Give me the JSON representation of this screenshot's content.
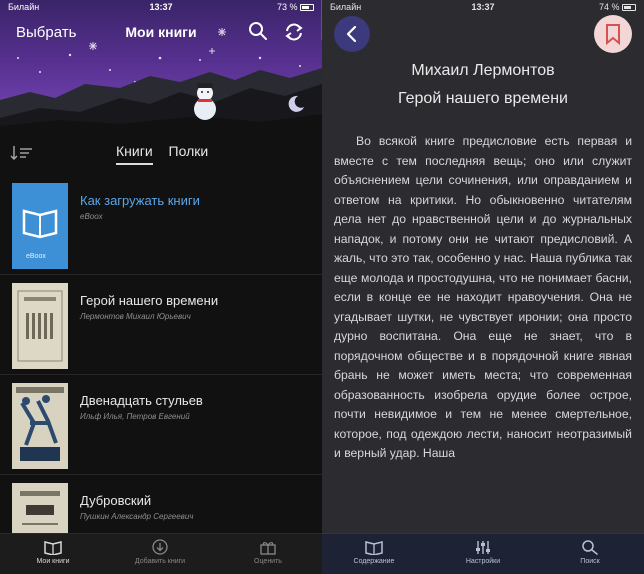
{
  "left": {
    "status": {
      "carrier": "Билайн",
      "time": "13:37",
      "battery": "73 %"
    },
    "nav": {
      "select_label": "Выбрать",
      "title": "Мои книги"
    },
    "tabs": [
      {
        "label": "Книги",
        "active": true
      },
      {
        "label": "Полки",
        "active": false
      }
    ],
    "books": [
      {
        "title": "Как загружать книги",
        "author": "eBoox",
        "cover_label": "eBoox",
        "link": true
      },
      {
        "title": "Герой нашего времени",
        "author": "Лермонтов Михаил Юрьевич",
        "link": false
      },
      {
        "title": "Двенадцать стульев",
        "author": "Ильф Илья, Петров Евгений",
        "link": false
      },
      {
        "title": "Дубровский",
        "author": "Пушкин Александр Сергеевич",
        "link": false
      }
    ],
    "tabbar": [
      {
        "label": "Мои книги",
        "icon": "book-icon",
        "active": true
      },
      {
        "label": "Добавить книги",
        "icon": "download-icon",
        "active": false
      },
      {
        "label": "Оценить",
        "icon": "gift-icon",
        "active": false
      }
    ]
  },
  "right": {
    "status": {
      "carrier": "Билайн",
      "time": "13:37",
      "battery": "74 %"
    },
    "author": "Михаил Лермонтов",
    "title": "Герой нашего времени",
    "text": "Во всякой книге предисловие есть первая и вместе с тем последняя вещь; оно или служит объяснением цели сочинения, или оправданием и ответом на критики. Но обыкновенно читателям дела нет до нравственной цели и до журнальных нападок, и потому они не читают предисловий. А жаль, что это так, особенно у нас. Наша публика так еще молода и простодушна, что не понимает басни, если в конце ее не находит нравоучения. Она не угадывает шутки, не чувствует иронии; она просто дурно воспитана. Она еще не знает, что в порядочном обществе и в порядочной книге явная брань не может иметь места; что современная образованность изобрела орудие более острое, почти невидимое и тем не менее смертельное, которое, под одеждою лести, наносит неотразимый и верный удар. Наша",
    "tabbar": [
      {
        "label": "Содержание",
        "icon": "book-icon"
      },
      {
        "label": "Настройки",
        "icon": "sliders-icon"
      },
      {
        "label": "Поиск",
        "icon": "search-icon"
      }
    ]
  },
  "colors": {
    "accent_link": "#5aa6e8",
    "reader_bg": "#2b2b30",
    "back_button": "#3c3a7d",
    "bookmark_button": "#f3d6d6"
  }
}
